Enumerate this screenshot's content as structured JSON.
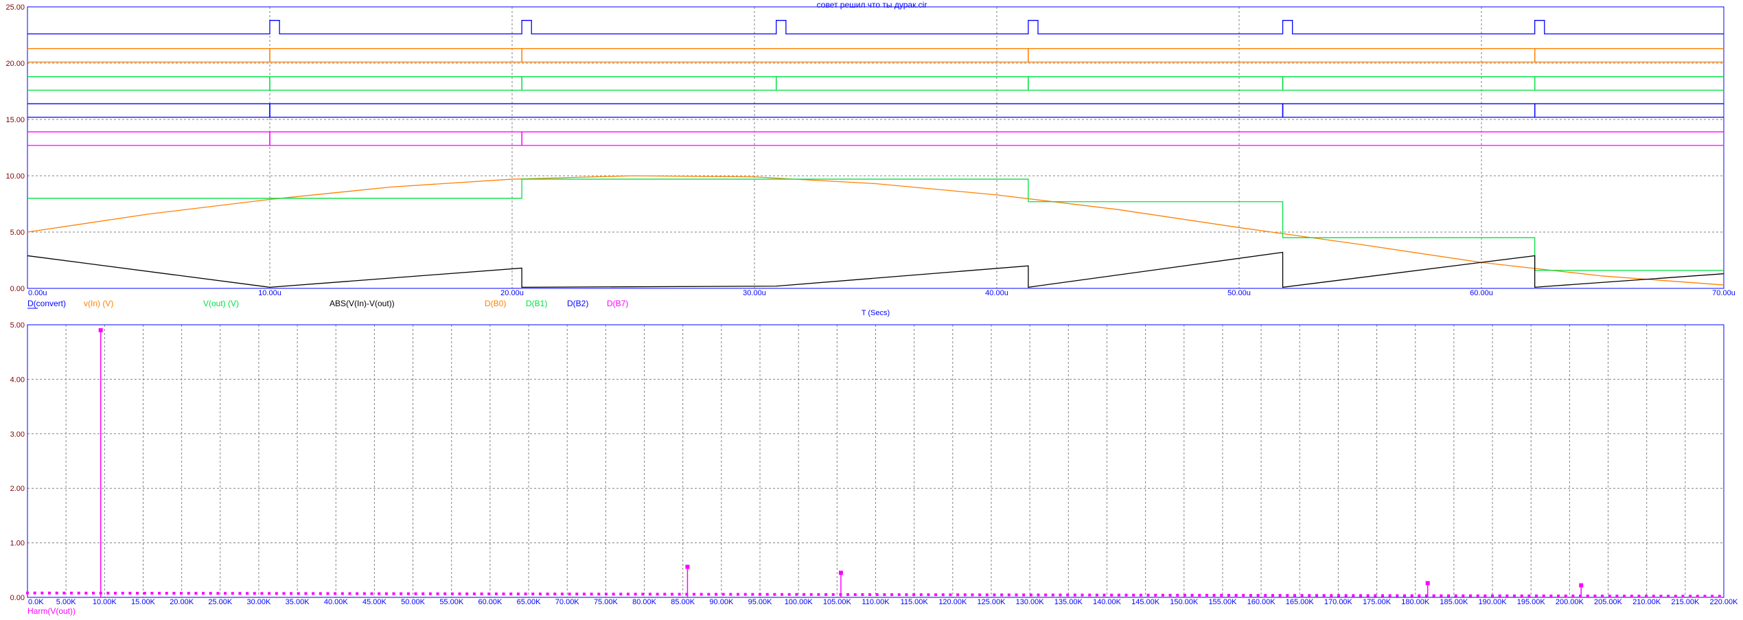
{
  "title": "совет решил что ты дурак.cir",
  "colors": {
    "axis": "#0000FF",
    "grid": "#808080",
    "ytick": "#800000"
  },
  "chart_data": [
    {
      "type": "line",
      "xlabel": "T (Secs)",
      "xlim": [
        0,
        70
      ],
      "ylim": [
        0,
        25
      ],
      "x_ticks": [
        0,
        10,
        20,
        30,
        40,
        50,
        60,
        70
      ],
      "x_tick_labels": [
        "0.00u",
        "10.00u",
        "20.00u",
        "30.00u",
        "40.00u",
        "50.00u",
        "60.00u",
        "70.00u"
      ],
      "y_ticks": [
        0,
        5,
        10,
        15,
        20,
        25
      ],
      "y_tick_labels": [
        "0.00",
        "5.00",
        "10.00",
        "15.00",
        "20.00",
        "25.00"
      ],
      "grid": true,
      "legend": [
        {
          "name": "D(convert)",
          "color": "#0000FF"
        },
        {
          "name": "v(In) (V)",
          "color": "#FF8000"
        },
        {
          "name": "V(out) (V)",
          "color": "#00E040"
        },
        {
          "name": "ABS(V(In)-V(out))",
          "color": "#000000"
        },
        {
          "name": "D(B0)",
          "color": "#FF8000"
        },
        {
          "name": "D(B1)",
          "color": "#00E040"
        },
        {
          "name": "D(B2)",
          "color": "#0000FF"
        },
        {
          "name": "D(B7)",
          "color": "#FF00FF"
        }
      ],
      "series": [
        {
          "name": "D(convert)",
          "color": "#0000FF",
          "kind": "step",
          "x": [
            0,
            10.0,
            10.0,
            10.4,
            10.4,
            20.4,
            20.4,
            20.8,
            20.8,
            30.9,
            30.9,
            31.3,
            31.3,
            41.3,
            41.3,
            41.7,
            41.7,
            51.8,
            51.8,
            52.2,
            52.2,
            62.2,
            62.2,
            62.6,
            62.6,
            70
          ],
          "y": [
            22.6,
            22.6,
            23.8,
            23.8,
            22.6,
            22.6,
            23.8,
            23.8,
            22.6,
            22.6,
            23.8,
            23.8,
            22.6,
            22.6,
            23.8,
            23.8,
            22.6,
            22.6,
            23.8,
            23.8,
            22.6,
            22.6,
            23.8,
            23.8,
            22.6,
            22.6
          ]
        },
        {
          "name": "D(B0)",
          "color": "#FF8000",
          "kind": "bus",
          "x": [
            0,
            10.0,
            20.4,
            41.3,
            62.2,
            70
          ],
          "hi": 21.3,
          "lo": 20.1
        },
        {
          "name": "D(B1)",
          "color": "#00E040",
          "kind": "bus",
          "x": [
            0,
            10.0,
            20.4,
            30.9,
            41.3,
            51.8,
            62.2,
            70
          ],
          "hi": 18.8,
          "lo": 17.6
        },
        {
          "name": "D(B2)",
          "color": "#0000FF",
          "kind": "bus",
          "x": [
            0,
            10.0,
            51.8,
            62.2,
            70
          ],
          "hi": 16.4,
          "lo": 15.2
        },
        {
          "name": "D(B7)",
          "color": "#FF00FF",
          "kind": "bus",
          "x": [
            0,
            10.0,
            20.4,
            70
          ],
          "hi": 13.9,
          "lo": 12.7
        },
        {
          "name": "v(In) (V)",
          "color": "#FF8000",
          "kind": "line",
          "x": [
            0,
            5,
            10,
            15,
            20,
            25,
            30,
            35,
            40,
            45,
            50,
            55,
            60,
            65,
            70
          ],
          "y": [
            5.0,
            6.6,
            7.9,
            9.0,
            9.7,
            10.0,
            9.9,
            9.3,
            8.3,
            7.0,
            5.4,
            3.9,
            2.3,
            1.1,
            0.3
          ]
        },
        {
          "name": "V(out) (V)",
          "color": "#00E040",
          "kind": "step",
          "x": [
            0,
            20.4,
            20.4,
            41.3,
            41.3,
            51.8,
            51.8,
            62.2,
            62.2,
            70
          ],
          "y": [
            8.0,
            8.0,
            9.7,
            9.7,
            7.7,
            7.7,
            4.5,
            4.5,
            1.6,
            1.6
          ]
        },
        {
          "name": "ABS(V(In)-V(out))",
          "color": "#000000",
          "kind": "line",
          "x": [
            0,
            10.0,
            20.4,
            20.4,
            30.9,
            41.3,
            41.3,
            51.8,
            51.8,
            62.2,
            62.2,
            70
          ],
          "y": [
            2.9,
            0.1,
            1.8,
            0.1,
            0.2,
            2.0,
            0.1,
            3.2,
            0.1,
            2.9,
            0.1,
            1.3
          ]
        }
      ]
    },
    {
      "type": "bar",
      "xlabel": "",
      "legend": [
        {
          "name": "Harm(V(out))",
          "color": "#FF00FF"
        }
      ],
      "xlim": [
        0,
        220
      ],
      "ylim": [
        0,
        5
      ],
      "x_ticks": [
        0,
        5,
        10,
        15,
        20,
        25,
        30,
        35,
        40,
        45,
        50,
        55,
        60,
        65,
        70,
        75,
        80,
        85,
        90,
        95,
        100,
        105,
        110,
        115,
        120,
        125,
        130,
        135,
        140,
        145,
        150,
        155,
        160,
        165,
        170,
        175,
        180,
        185,
        190,
        195,
        200,
        205,
        210,
        215,
        220
      ],
      "x_tick_labels": [
        "0.0K",
        "5.00K",
        "10.00K",
        "15.00K",
        "20.00K",
        "25.00K",
        "30.00K",
        "35.00K",
        "40.00K",
        "45.00K",
        "50.00K",
        "55.00K",
        "60.00K",
        "65.00K",
        "70.00K",
        "75.00K",
        "80.00K",
        "85.00K",
        "90.00K",
        "95.00K",
        "100.00K",
        "105.00K",
        "110.00K",
        "115.00K",
        "120.00K",
        "125.00K",
        "130.00K",
        "135.00K",
        "140.00K",
        "145.00K",
        "150.00K",
        "155.00K",
        "160.00K",
        "165.00K",
        "170.00K",
        "175.00K",
        "180.00K",
        "185.00K",
        "190.00K",
        "195.00K",
        "200.00K",
        "205.00K",
        "210.00K",
        "215.00K",
        "220.00K"
      ],
      "y_ticks": [
        0,
        1,
        2,
        3,
        4,
        5
      ],
      "y_tick_labels": [
        "0.00",
        "1.00",
        "2.00",
        "3.00",
        "4.00",
        "5.00"
      ],
      "grid": true,
      "peaks": [
        {
          "x": 9.5,
          "y": 4.9
        },
        {
          "x": 85.6,
          "y": 0.56
        },
        {
          "x": 105.5,
          "y": 0.45
        },
        {
          "x": 181.6,
          "y": 0.26
        },
        {
          "x": 201.5,
          "y": 0.22
        }
      ],
      "floor": {
        "from": 0,
        "to": 220,
        "step": 0.95,
        "start_level": 0.08,
        "end_level": 0.02
      },
      "color": "#FF00FF"
    }
  ]
}
